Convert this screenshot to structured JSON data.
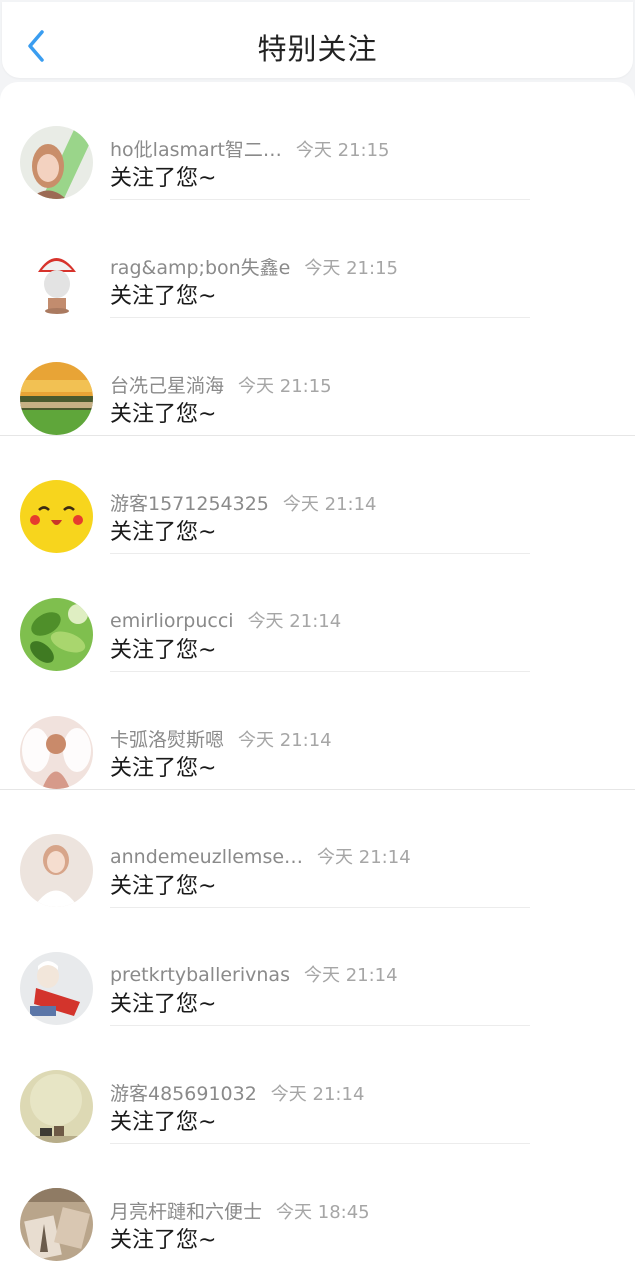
{
  "header": {
    "title": "特别关注",
    "back_icon": "chevron-left-icon",
    "accent": "#3a9df0"
  },
  "rows": [
    {
      "name": "ho仳lasmart智二…",
      "time": "今天 21:15",
      "message": "关注了您~"
    },
    {
      "name": "rag&amp;bon失鑫e",
      "time": "今天 21:15",
      "message": "关注了您~"
    },
    {
      "name": "台冼己星淌海",
      "time": "今天 21:15",
      "message": "关注了您~"
    },
    {
      "name": "游客1571254325",
      "time": "今天 21:14",
      "message": "关注了您~"
    },
    {
      "name": "emirliorpucci",
      "time": "今天 21:14",
      "message": "关注了您~"
    },
    {
      "name": "卡弧洛熨斯嗯",
      "time": "今天 21:14",
      "message": "关注了您~"
    },
    {
      "name": "anndemeuzllemse…",
      "time": "今天 21:14",
      "message": "关注了您~"
    },
    {
      "name": "pretkrtyballerivnas",
      "time": "今天 21:14",
      "message": "关注了您~"
    },
    {
      "name": "游客485691032",
      "time": "今天 21:14",
      "message": "关注了您~"
    },
    {
      "name": "月亮杆蹥和六便士",
      "time": "今天 18:45",
      "message": "关注了您~"
    }
  ]
}
